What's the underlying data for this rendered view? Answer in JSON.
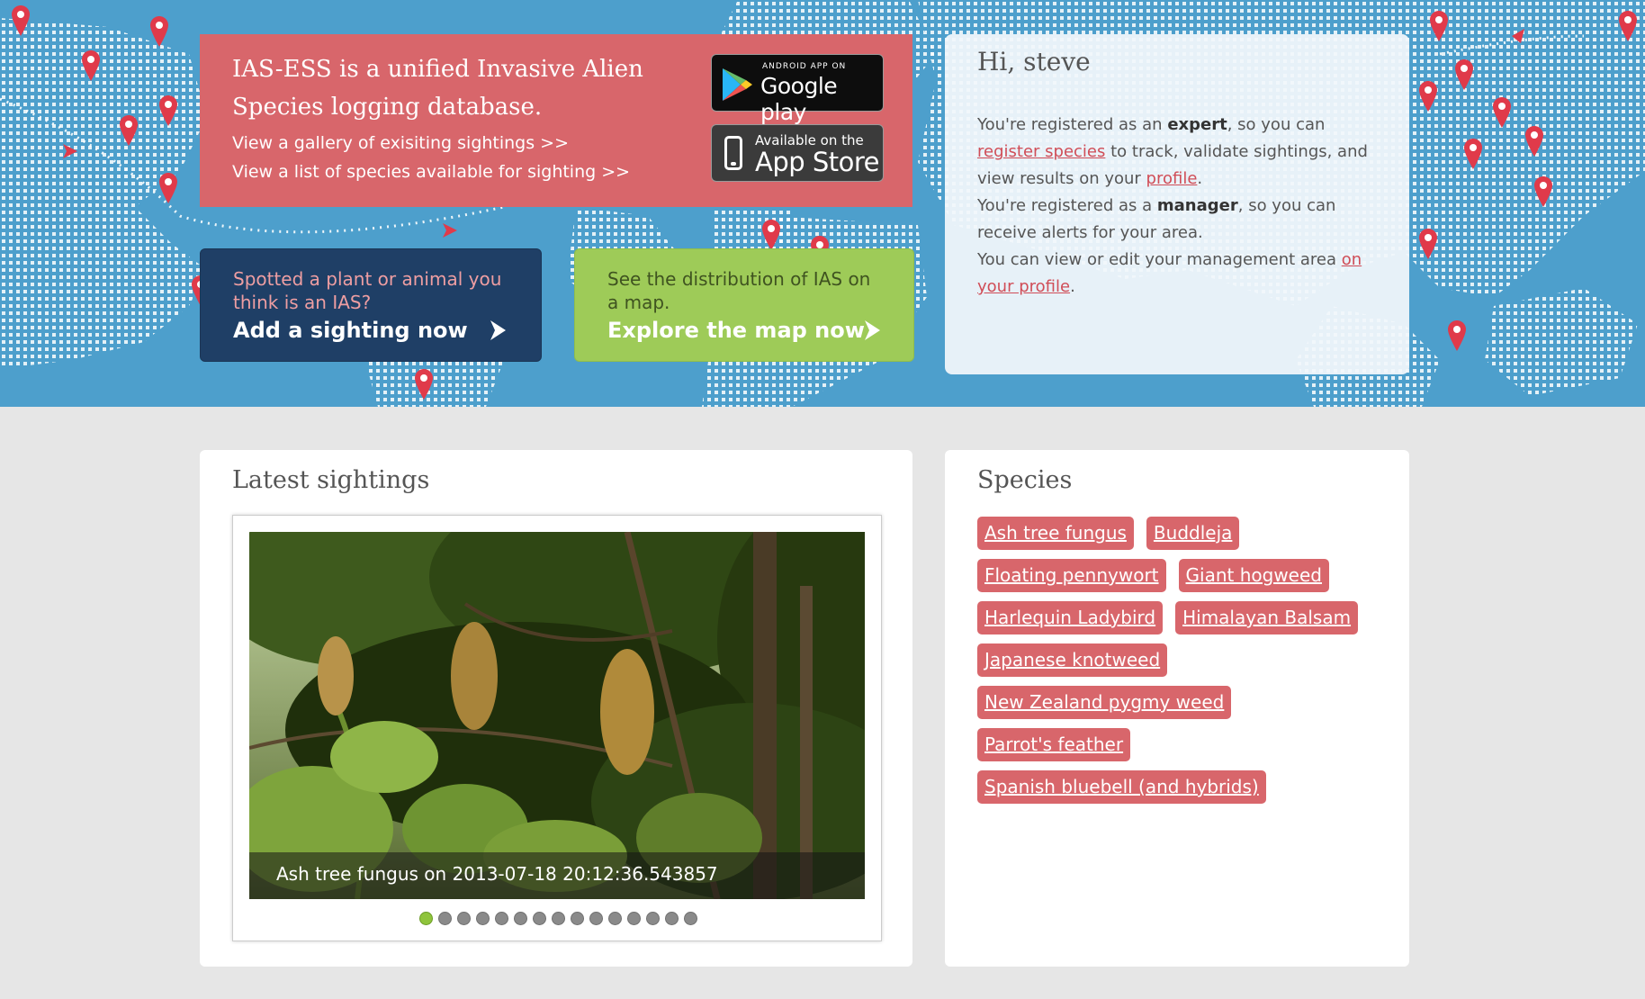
{
  "hero": {
    "intro": {
      "title": "IAS-ESS is a unified Invasive Alien Species logging database.",
      "gallery_link": "View a gallery of exisiting sightings >>",
      "species_link": "View a list of species available for sighting >>"
    },
    "google_play": {
      "small_text": "ANDROID APP ON",
      "big_text": "Google play"
    },
    "app_store": {
      "small_text": "Available on the",
      "big_text": "App Store"
    },
    "add_sighting": {
      "question": "Spotted a plant or animal you think is an IAS?",
      "action": "Add a sighting now",
      "icon": "arrow-right-icon"
    },
    "explore_map": {
      "question": "See the distribution of IAS on a map.",
      "action": "Explore the map now",
      "icon": "arrow-right-icon"
    }
  },
  "user_panel": {
    "greeting": "Hi, steve",
    "line1_a": "You're registered as an ",
    "line1_role": "expert",
    "line1_b": ", so you can ",
    "line1_link": "register species",
    "line1_c": " to track, validate sightings, and view results on your ",
    "line1_profile_link": "profile",
    "line1_d": ".",
    "line2_a": "You're registered as a ",
    "line2_role": "manager",
    "line2_b": ", so you can receive alerts for your area.",
    "line3_a": "You can view or edit your management area ",
    "line3_link": "on your profile",
    "line3_b": "."
  },
  "latest_sightings": {
    "title": "Latest sightings",
    "caption": "Ash tree fungus on 2013-07-18 20:12:36.543857",
    "slide_count": 15,
    "active_slide": 1
  },
  "species": {
    "title": "Species",
    "rows": [
      [
        "Ash tree fungus",
        "Buddleja"
      ],
      [
        "Floating pennywort",
        "Giant hogweed"
      ],
      [
        "Harlequin Ladybird",
        "Himalayan Balsam"
      ],
      [
        "Japanese knotweed"
      ],
      [
        "New Zealand pygmy weed"
      ],
      [
        "Parrot's feather"
      ],
      [
        "Spanish bluebell (and hybrids)"
      ]
    ]
  },
  "colors": {
    "map_blue": "#4d9fcc",
    "brand_red": "#d8666b",
    "navy": "#1f3f66",
    "lime": "#9ecb58",
    "dot_active": "#8fc43c"
  }
}
